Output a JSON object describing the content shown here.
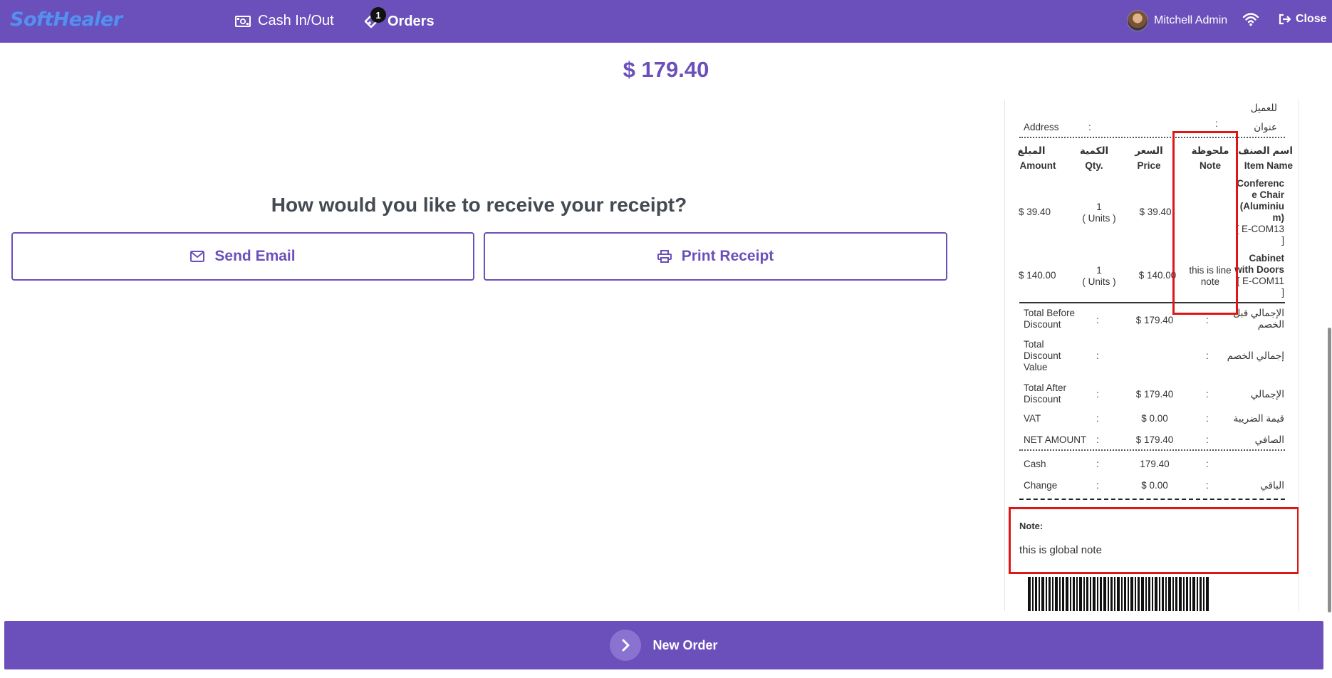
{
  "header": {
    "logo": "SoftHealer",
    "cash_label": "Cash In/Out",
    "orders_label": "Orders",
    "orders_badge": "1",
    "user_name": "Mitchell Admin",
    "close_label": "Close",
    "icons": [
      "cash-icon",
      "orders-icon",
      "avatar",
      "wifi-icon",
      "sign-out-icon"
    ]
  },
  "payment": {
    "total": "$ 179.40",
    "question": "How would you like to receive your receipt?",
    "send_email_label": "Send Email",
    "print_receipt_label": "Print Receipt"
  },
  "receipt": {
    "customer_ar": "للعميل",
    "address_label": "Address",
    "address_ar": "عنوان",
    "columns": {
      "amount_ar": "المبلغ",
      "amount": "Amount",
      "qty_ar": "الكمية",
      "qty": "Qty.",
      "price_ar": "السعر",
      "price": "Price",
      "note_ar": "ملحوظة",
      "note": "Note",
      "item_ar": "اسم الصنف",
      "item": "Item Name"
    },
    "lines": [
      {
        "amount": "$ 39.40",
        "qty": "1",
        "unit": "( Units )",
        "price": "$ 39.40",
        "note": "",
        "name": [
          "Conferenc",
          "e Chair",
          "(Aluminiu",
          "m)"
        ],
        "code": [
          "[ E-COM13",
          "]"
        ]
      },
      {
        "amount": "$ 140.00",
        "qty": "1",
        "unit": "( Units )",
        "price": "$ 140.00",
        "note": [
          "this is line",
          "note"
        ],
        "name": [
          "Cabinet",
          "with Doors"
        ],
        "code": [
          "[ E-COM11",
          "]"
        ]
      }
    ],
    "totals": [
      {
        "label": [
          "Total Before",
          "Discount"
        ],
        "value": "$ 179.40",
        "ar": [
          "الإجمالي قبل",
          "الخصم"
        ]
      },
      {
        "label": [
          "Total",
          "Discount",
          "Value"
        ],
        "value": "",
        "ar": [
          "إجمالي الخصم"
        ]
      },
      {
        "label": [
          "Total After",
          "Discount"
        ],
        "value": "$ 179.40",
        "ar": [
          "الإجمالي"
        ]
      },
      {
        "label": [
          "VAT"
        ],
        "value": "$ 0.00",
        "ar": [
          "قيمة الضريبة"
        ]
      },
      {
        "label": [
          "NET AMOUNT"
        ],
        "value": "$ 179.40",
        "ar": [
          "الصافي"
        ]
      }
    ],
    "payments": [
      {
        "label": "Cash",
        "value": "179.40",
        "ar": ""
      },
      {
        "label": "Change",
        "value": "$ 0.00",
        "ar": "الباقي"
      }
    ],
    "note_title": "Note:",
    "global_note": "this is global note",
    "colon": ":"
  },
  "footer": {
    "new_order_label": "New Order"
  },
  "colors": {
    "brand": "#6b4fbb",
    "highlight": "#e01616"
  }
}
